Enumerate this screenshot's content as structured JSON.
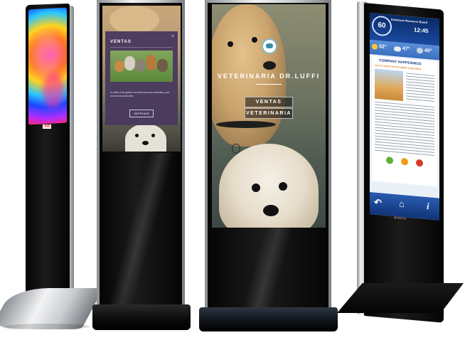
{
  "scene": {
    "background": "#ffffff",
    "accent_purple": "#4a3a5e",
    "kiosk_black": "#0b0b0b",
    "silver": "#d7d9dc"
  },
  "kiosk2": {
    "dialog_title": "VENTAS",
    "close_symbol": "×",
    "body_text": "A cuidar a los gatitos con amor para tus mascotas y por tus nuevos productos",
    "print_button": "IMPRIMIR"
  },
  "kiosk3": {
    "title": "VETERINARIA DR.LUFFI",
    "logo_icon": "paw-icon",
    "menu": [
      "VENTAS",
      "VETERINARIA"
    ]
  },
  "kiosk4": {
    "header_title": "Employee Resource Board",
    "time": "12:45",
    "weather": [
      {
        "icon": "sun-icon",
        "temp": "52°"
      },
      {
        "icon": "cloud-icon",
        "temp": "47°"
      },
      {
        "icon": "rain-icon",
        "temp": "40°"
      }
    ],
    "section_title": "COMPANY HAPPENINGS",
    "subtitle": "COLLECTIONS FOR UPCOMING FOOD DRIVE",
    "buttons": [
      "",
      "",
      ""
    ],
    "nav_icons": [
      "back-arrow-icon",
      "home-icon",
      "info-icon"
    ],
    "brand": "MIRATA"
  },
  "kiosk1": {
    "bottom_logo": "AIS"
  }
}
